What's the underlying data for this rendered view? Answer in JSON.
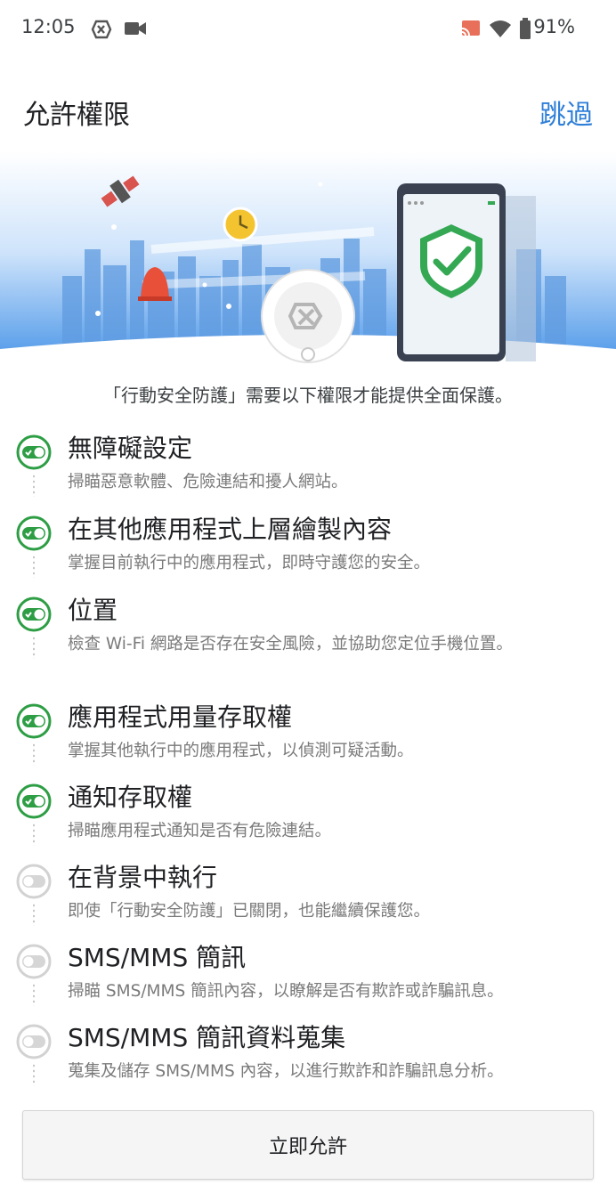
{
  "status_bar": {
    "time": "12:05",
    "battery": "91%",
    "icons": [
      "app-shield-icon",
      "video-camera-icon",
      "cast-icon",
      "wifi-icon",
      "battery-icon"
    ]
  },
  "header": {
    "title": "允許權限",
    "skip_label": "跳過"
  },
  "intro_text": "「行動安全防護」需要以下權限才能提供全面保護。",
  "permissions": [
    {
      "title": "無障礙設定",
      "desc": "掃瞄惡意軟體、危險連結和擾人網站。",
      "enabled": true
    },
    {
      "title": "在其他應用程式上層繪製內容",
      "desc": "掌握目前執行中的應用程式，即時守護您的安全。",
      "enabled": true
    },
    {
      "title": "位置",
      "desc": "檢查 Wi-Fi 網路是否存在安全風險，並協助您定位手機位置。",
      "enabled": true
    },
    {
      "title": "應用程式用量存取權",
      "desc": "掌握其他執行中的應用程式，以偵測可疑活動。",
      "enabled": true
    },
    {
      "title": "通知存取權",
      "desc": "掃瞄應用程式通知是否有危險連結。",
      "enabled": true
    },
    {
      "title": "在背景中執行",
      "desc": "即使「行動安全防護」已關閉，也能繼續保護您。",
      "enabled": false
    },
    {
      "title": "SMS/MMS 簡訊",
      "desc": "掃瞄 SMS/MMS 簡訊內容，以瞭解是否有欺詐或詐騙訊息。",
      "enabled": false
    },
    {
      "title": "SMS/MMS 簡訊資料蒐集",
      "desc": "蒐集及儲存 SMS/MMS 內容，以進行欺詐和詐騙訊息分析。",
      "enabled": false
    }
  ],
  "allow_button_label": "立即允許",
  "colors": {
    "accent_blue": "#2f7fd8",
    "toggle_on": "#2e9e45",
    "toggle_off": "#c8c8c8",
    "hero_sky": "#3f8fe6",
    "shield_green": "#34a853"
  }
}
